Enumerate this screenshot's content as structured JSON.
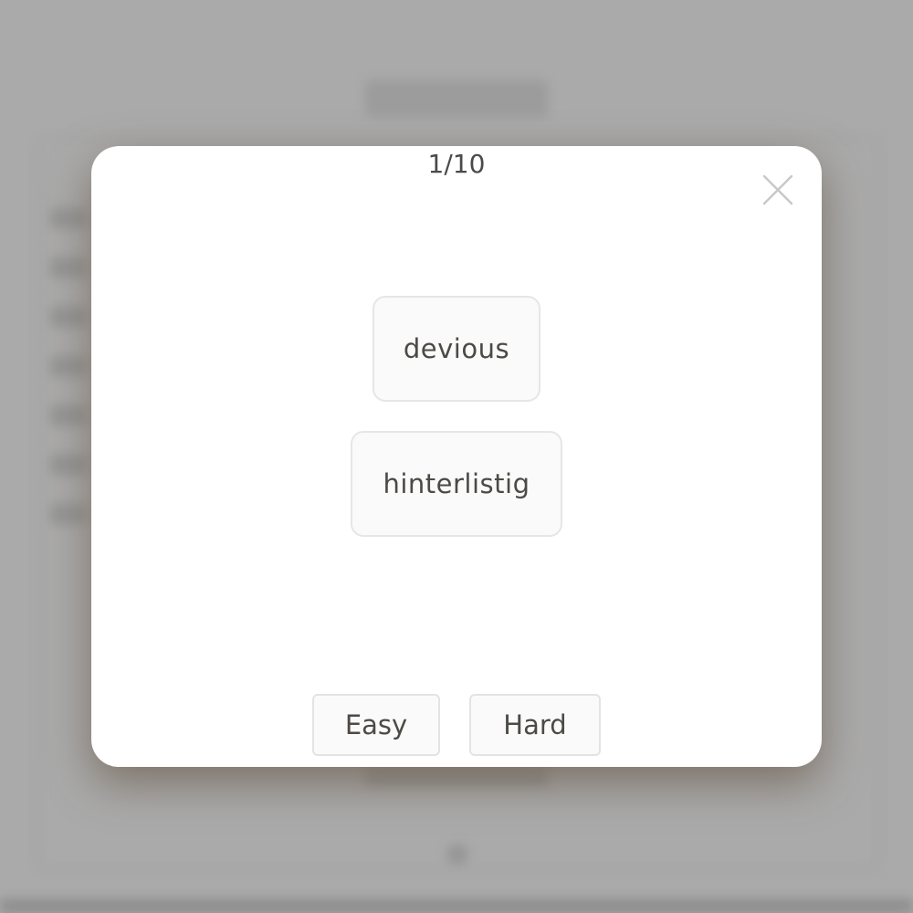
{
  "flashcard": {
    "counter": "1/10",
    "front": "devious",
    "back": "hinterlistig"
  },
  "buttons": {
    "easy_label": "Easy",
    "hard_label": "Hard",
    "close_icon": "close-icon"
  },
  "colors": {
    "overlay": "#aaaaaa",
    "modal_background": "#ffffff",
    "card_background": "#fafafa",
    "card_border": "#e6e6e6",
    "text": "#4d4a46",
    "close_icon": "#c8c8c8"
  }
}
